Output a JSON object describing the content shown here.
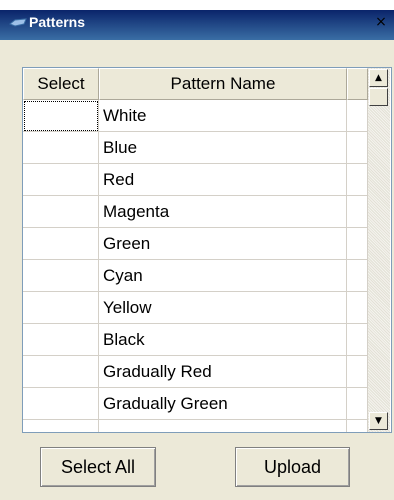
{
  "window": {
    "title": "Patterns",
    "close_glyph": "×"
  },
  "grid": {
    "columns": [
      "Select",
      "Pattern Name"
    ],
    "rows": [
      {
        "pattern": "White"
      },
      {
        "pattern": "Blue"
      },
      {
        "pattern": "Red"
      },
      {
        "pattern": "Magenta"
      },
      {
        "pattern": "Green"
      },
      {
        "pattern": "Cyan"
      },
      {
        "pattern": "Yellow"
      },
      {
        "pattern": "Black"
      },
      {
        "pattern": "Gradually Red"
      },
      {
        "pattern": "Gradually Green"
      }
    ]
  },
  "scrollbar": {
    "up_glyph": "▲",
    "down_glyph": "▼"
  },
  "buttons": {
    "select_all": "Select All",
    "upload": "Upload"
  },
  "colors": {
    "titlebar": "#0A246A",
    "face": "#ECE9D8",
    "grid_border": "#7F9DB9"
  },
  "icons": [
    "title-app-icon",
    "close-icon",
    "scroll-up-icon",
    "scroll-down-icon"
  ]
}
